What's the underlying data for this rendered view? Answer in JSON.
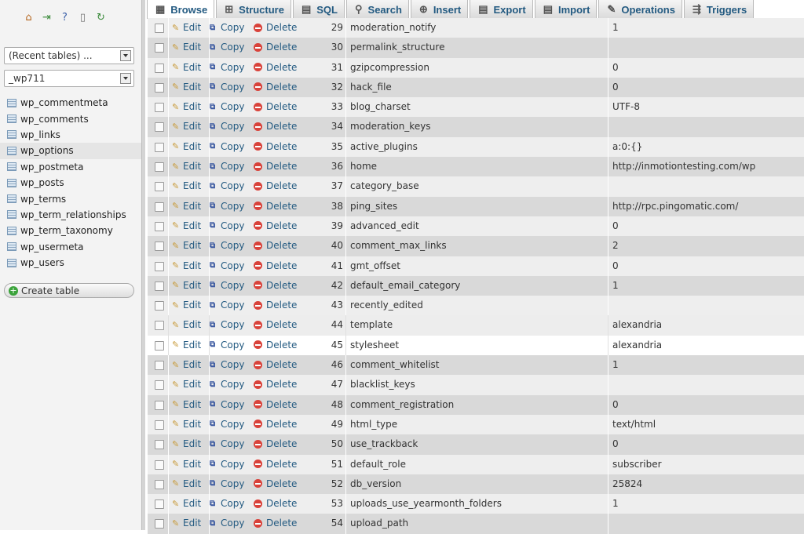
{
  "sidebar": {
    "recent_tables": "(Recent tables) ...",
    "database": "_wp711",
    "tables": [
      "wp_commentmeta",
      "wp_comments",
      "wp_links",
      "wp_options",
      "wp_postmeta",
      "wp_posts",
      "wp_terms",
      "wp_term_relationships",
      "wp_term_taxonomy",
      "wp_usermeta",
      "wp_users"
    ],
    "active_table": "wp_options",
    "create_table_label": "Create table"
  },
  "tabs": [
    {
      "label": "Browse",
      "icon": "browse-icon"
    },
    {
      "label": "Structure",
      "icon": "structure-icon"
    },
    {
      "label": "SQL",
      "icon": "sql-icon"
    },
    {
      "label": "Search",
      "icon": "search-icon"
    },
    {
      "label": "Insert",
      "icon": "insert-icon"
    },
    {
      "label": "Export",
      "icon": "export-icon"
    },
    {
      "label": "Import",
      "icon": "import-icon"
    },
    {
      "label": "Operations",
      "icon": "operations-icon"
    },
    {
      "label": "Triggers",
      "icon": "triggers-icon"
    }
  ],
  "actions": {
    "edit": "Edit",
    "copy": "Copy",
    "delete": "Delete"
  },
  "rows": [
    {
      "id": "29",
      "name": "moderation_notify",
      "value": "1"
    },
    {
      "id": "30",
      "name": "permalink_structure",
      "value": ""
    },
    {
      "id": "31",
      "name": "gzipcompression",
      "value": "0"
    },
    {
      "id": "32",
      "name": "hack_file",
      "value": "0"
    },
    {
      "id": "33",
      "name": "blog_charset",
      "value": "UTF-8"
    },
    {
      "id": "34",
      "name": "moderation_keys",
      "value": ""
    },
    {
      "id": "35",
      "name": "active_plugins",
      "value": "a:0:{}"
    },
    {
      "id": "36",
      "name": "home",
      "value": "http://inmotiontesting.com/wp"
    },
    {
      "id": "37",
      "name": "category_base",
      "value": ""
    },
    {
      "id": "38",
      "name": "ping_sites",
      "value": "http://rpc.pingomatic.com/"
    },
    {
      "id": "39",
      "name": "advanced_edit",
      "value": "0"
    },
    {
      "id": "40",
      "name": "comment_max_links",
      "value": "2"
    },
    {
      "id": "41",
      "name": "gmt_offset",
      "value": "0"
    },
    {
      "id": "42",
      "name": "default_email_category",
      "value": "1"
    },
    {
      "id": "43",
      "name": "recently_edited",
      "value": ""
    },
    {
      "id": "44",
      "name": "template",
      "value": "alexandria"
    },
    {
      "id": "45",
      "name": "stylesheet",
      "value": "alexandria"
    },
    {
      "id": "46",
      "name": "comment_whitelist",
      "value": "1"
    },
    {
      "id": "47",
      "name": "blacklist_keys",
      "value": ""
    },
    {
      "id": "48",
      "name": "comment_registration",
      "value": "0"
    },
    {
      "id": "49",
      "name": "html_type",
      "value": "text/html"
    },
    {
      "id": "50",
      "name": "use_trackback",
      "value": "0"
    },
    {
      "id": "51",
      "name": "default_role",
      "value": "subscriber"
    },
    {
      "id": "52",
      "name": "db_version",
      "value": "25824"
    },
    {
      "id": "53",
      "name": "uploads_use_yearmonth_folders",
      "value": "1"
    },
    {
      "id": "54",
      "name": "upload_path",
      "value": ""
    }
  ]
}
